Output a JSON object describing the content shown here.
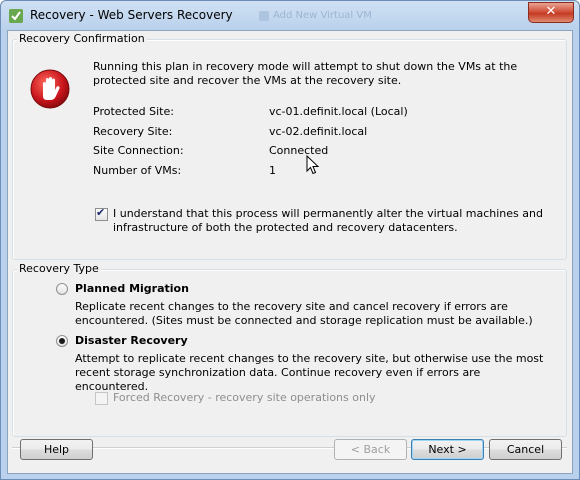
{
  "window": {
    "title": "Recovery - Web Servers Recovery",
    "background_title": "Add New Virtual VM",
    "close_label": "✕"
  },
  "confirmation": {
    "legend": "Recovery Confirmation",
    "warning_icon": "stop-hand-icon",
    "message": "Running this plan in recovery mode will attempt to shut down the VMs at the protected site and recover the VMs at the recovery site.",
    "fields": [
      {
        "label": "Protected Site:",
        "value": "vc-01.definit.local (Local)"
      },
      {
        "label": "Recovery Site:",
        "value": "vc-02.definit.local"
      },
      {
        "label": "Site Connection:",
        "value": "Connected"
      },
      {
        "label": "Number of VMs:",
        "value": "1"
      }
    ],
    "acknowledge_checked": true,
    "acknowledge_text": "I understand that this process will permanently alter the virtual machines and infrastructure of both the protected and recovery datacenters."
  },
  "recovery_type": {
    "legend": "Recovery Type",
    "options": [
      {
        "label": "Planned Migration",
        "selected": false,
        "description": "Replicate recent changes to the recovery site and cancel recovery if errors are encountered. (Sites must be connected and storage replication must be available.)"
      },
      {
        "label": "Disaster Recovery",
        "selected": true,
        "description": "Attempt to replicate recent changes to the recovery site, but otherwise use the most recent storage synchronization data. Continue recovery even if errors are encountered."
      }
    ],
    "forced_recovery_label": "Forced Recovery - recovery site operations only",
    "forced_recovery_checked": false,
    "forced_recovery_enabled": false
  },
  "buttons": {
    "help": "Help",
    "back": "< Back",
    "next": "Next >",
    "cancel": "Cancel"
  },
  "colors": {
    "title_bar": "#b9d1ec",
    "close_button": "#c43a22",
    "stop_icon": "#c8141b"
  }
}
